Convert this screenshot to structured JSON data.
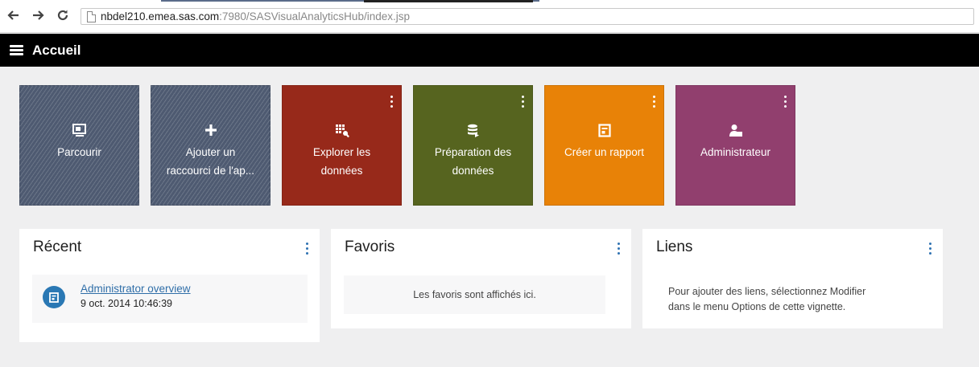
{
  "browser": {
    "back_icon": "arrow-left-icon",
    "forward_icon": "arrow-right-icon",
    "reload_icon": "reload-icon",
    "url_host": "nbdel210.emea.sas.com",
    "url_rest": ":7980/SASVisualAnalyticsHub/index.jsp"
  },
  "appbar": {
    "menu_icon": "hamburger-icon",
    "title": "Accueil"
  },
  "tiles": [
    {
      "label_1": "Parcourir",
      "label_2": "",
      "icon": "browse-monitor-icon",
      "color": "#4e5a71",
      "has_menu": false
    },
    {
      "label_1": "Ajouter un",
      "label_2": "raccourci de l'ap...",
      "icon": "plus-icon",
      "color": "#4e5a71",
      "has_menu": false
    },
    {
      "label_1": "Explorer les",
      "label_2": "données",
      "icon": "explore-grid-icon",
      "color": "#97291a",
      "has_menu": true
    },
    {
      "label_1": "Préparation des",
      "label_2": "données",
      "icon": "database-icon",
      "color": "#56641f",
      "has_menu": true
    },
    {
      "label_1": "Créer un rapport",
      "label_2": "",
      "icon": "report-icon",
      "color": "#e88207",
      "has_menu": true
    },
    {
      "label_1": "Administrateur",
      "label_2": "",
      "icon": "admin-users-icon",
      "color": "#913f6e",
      "has_menu": true
    }
  ],
  "cards": {
    "recent": {
      "title": "Récent",
      "item_icon": "report-icon",
      "item_link": "Administrator overview",
      "item_date": "9 oct. 2014 10:46:39"
    },
    "favorites": {
      "title": "Favoris",
      "empty_text": "Les favoris sont affichés ici."
    },
    "links": {
      "title": "Liens",
      "help_line_1": "Pour ajouter des liens, sélectionnez Modifier",
      "help_line_2": "dans le menu Options de cette vignette."
    }
  },
  "colors": {
    "accent_blue": "#2f72b2",
    "appbar_bg": "#000000",
    "page_bg": "#efeff0"
  }
}
